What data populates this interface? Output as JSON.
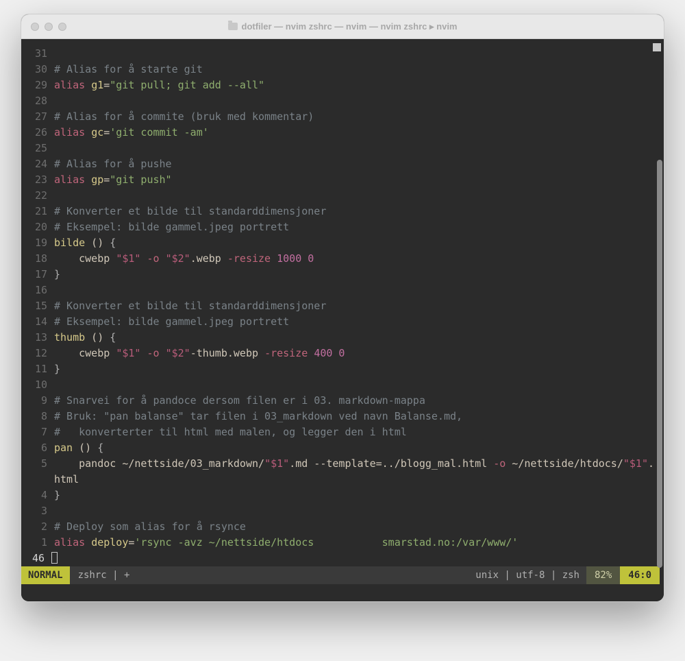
{
  "window": {
    "title": "dotfiler — nvim zshrc — nvim — nvim zshrc ▸ nvim"
  },
  "statusline": {
    "mode": "NORMAL",
    "file": "zshrc | +",
    "info": "unix | utf-8 | zsh",
    "percent": "82%",
    "pos": "46:0"
  },
  "cursor_line_gutter": "46",
  "lines": [
    {
      "g": "31",
      "tokens": []
    },
    {
      "g": "30",
      "tokens": [
        {
          "t": "# Alias for å starte git",
          "c": "c-comment"
        }
      ]
    },
    {
      "g": "29",
      "tokens": [
        {
          "t": "alias",
          "c": "c-keyword"
        },
        {
          "t": " ",
          "c": ""
        },
        {
          "t": "g1",
          "c": "c-ident"
        },
        {
          "t": "=",
          "c": "c-text"
        },
        {
          "t": "\"git pull; git add --all\"",
          "c": "c-string"
        }
      ]
    },
    {
      "g": "28",
      "tokens": []
    },
    {
      "g": "27",
      "tokens": [
        {
          "t": "# Alias for å commite (bruk med kommentar)",
          "c": "c-comment"
        }
      ]
    },
    {
      "g": "26",
      "tokens": [
        {
          "t": "alias",
          "c": "c-keyword"
        },
        {
          "t": " ",
          "c": ""
        },
        {
          "t": "gc",
          "c": "c-ident"
        },
        {
          "t": "=",
          "c": "c-text"
        },
        {
          "t": "'git commit -am'",
          "c": "c-string"
        }
      ]
    },
    {
      "g": "25",
      "tokens": []
    },
    {
      "g": "24",
      "tokens": [
        {
          "t": "# Alias for å pushe",
          "c": "c-comment"
        }
      ]
    },
    {
      "g": "23",
      "tokens": [
        {
          "t": "alias",
          "c": "c-keyword"
        },
        {
          "t": " ",
          "c": ""
        },
        {
          "t": "gp",
          "c": "c-ident"
        },
        {
          "t": "=",
          "c": "c-text"
        },
        {
          "t": "\"git push\"",
          "c": "c-string"
        }
      ]
    },
    {
      "g": "22",
      "tokens": []
    },
    {
      "g": "21",
      "tokens": [
        {
          "t": "# Konverter et bilde til standarddimensjoner",
          "c": "c-comment"
        }
      ]
    },
    {
      "g": "20",
      "tokens": [
        {
          "t": "# Eksempel: bilde gammel.jpeg portrett",
          "c": "c-comment"
        }
      ]
    },
    {
      "g": "19",
      "tokens": [
        {
          "t": "bilde",
          "c": "c-func"
        },
        {
          "t": " () ",
          "c": "c-text"
        },
        {
          "t": "{",
          "c": "c-brace"
        }
      ]
    },
    {
      "g": "18",
      "tokens": [
        {
          "t": "    cwebp ",
          "c": "c-text"
        },
        {
          "t": "\"$1\"",
          "c": "c-strvar"
        },
        {
          "t": " ",
          "c": ""
        },
        {
          "t": "-o",
          "c": "c-flag"
        },
        {
          "t": " ",
          "c": ""
        },
        {
          "t": "\"$2\"",
          "c": "c-strvar"
        },
        {
          "t": ".webp ",
          "c": "c-text"
        },
        {
          "t": "-resize",
          "c": "c-flag"
        },
        {
          "t": " ",
          "c": ""
        },
        {
          "t": "1000 0",
          "c": "c-num"
        }
      ]
    },
    {
      "g": "17",
      "tokens": [
        {
          "t": "}",
          "c": "c-brace"
        }
      ]
    },
    {
      "g": "16",
      "tokens": []
    },
    {
      "g": "15",
      "tokens": [
        {
          "t": "# Konverter et bilde til standarddimensjoner",
          "c": "c-comment"
        }
      ]
    },
    {
      "g": "14",
      "tokens": [
        {
          "t": "# Eksempel: bilde gammel.jpeg portrett",
          "c": "c-comment"
        }
      ]
    },
    {
      "g": "13",
      "tokens": [
        {
          "t": "thumb",
          "c": "c-func"
        },
        {
          "t": " () ",
          "c": "c-text"
        },
        {
          "t": "{",
          "c": "c-brace"
        }
      ]
    },
    {
      "g": "12",
      "tokens": [
        {
          "t": "    cwebp ",
          "c": "c-text"
        },
        {
          "t": "\"$1\"",
          "c": "c-strvar"
        },
        {
          "t": " ",
          "c": ""
        },
        {
          "t": "-o",
          "c": "c-flag"
        },
        {
          "t": " ",
          "c": ""
        },
        {
          "t": "\"$2\"",
          "c": "c-strvar"
        },
        {
          "t": "-thumb.webp ",
          "c": "c-text"
        },
        {
          "t": "-resize",
          "c": "c-flag"
        },
        {
          "t": " ",
          "c": ""
        },
        {
          "t": "400 0",
          "c": "c-num"
        }
      ]
    },
    {
      "g": "11",
      "tokens": [
        {
          "t": "}",
          "c": "c-brace"
        }
      ]
    },
    {
      "g": "10",
      "tokens": []
    },
    {
      "g": "9",
      "tokens": [
        {
          "t": "# Snarvei for å pandoce dersom filen er i 03. markdown-mappa",
          "c": "c-comment"
        }
      ]
    },
    {
      "g": "8",
      "tokens": [
        {
          "t": "# Bruk: \"pan balanse\" tar filen i 03_markdown ved navn Balanse.md,",
          "c": "c-comment"
        }
      ]
    },
    {
      "g": "7",
      "tokens": [
        {
          "t": "#   konverterter til html med malen, og legger den i html",
          "c": "c-comment"
        }
      ]
    },
    {
      "g": "6",
      "tokens": [
        {
          "t": "pan",
          "c": "c-func"
        },
        {
          "t": " () ",
          "c": "c-text"
        },
        {
          "t": "{",
          "c": "c-brace"
        }
      ]
    },
    {
      "g": "5",
      "tokens": [
        {
          "t": "    pandoc ~/nettside/03_markdown/",
          "c": "c-text"
        },
        {
          "t": "\"$1\"",
          "c": "c-strvar"
        },
        {
          "t": ".md --template=../blogg_mal.html ",
          "c": "c-text"
        },
        {
          "t": "-o",
          "c": "c-flag"
        },
        {
          "t": " ~/nettside/htdocs/",
          "c": "c-text"
        },
        {
          "t": "\"$1\"",
          "c": "c-strvar"
        },
        {
          "t": ".html",
          "c": "c-text"
        }
      ]
    },
    {
      "g": "4",
      "tokens": [
        {
          "t": "}",
          "c": "c-brace"
        }
      ]
    },
    {
      "g": "3",
      "tokens": []
    },
    {
      "g": "2",
      "tokens": [
        {
          "t": "# Deploy som alias for å rsynce",
          "c": "c-comment"
        }
      ]
    },
    {
      "g": "1",
      "tokens": [
        {
          "t": "alias",
          "c": "c-keyword"
        },
        {
          "t": " ",
          "c": ""
        },
        {
          "t": "deploy",
          "c": "c-ident"
        },
        {
          "t": "=",
          "c": "c-text"
        },
        {
          "t": "'rsync -avz ~/nettside/htdocs           smarstad.no:/var/www/'",
          "c": "c-string"
        }
      ]
    }
  ]
}
